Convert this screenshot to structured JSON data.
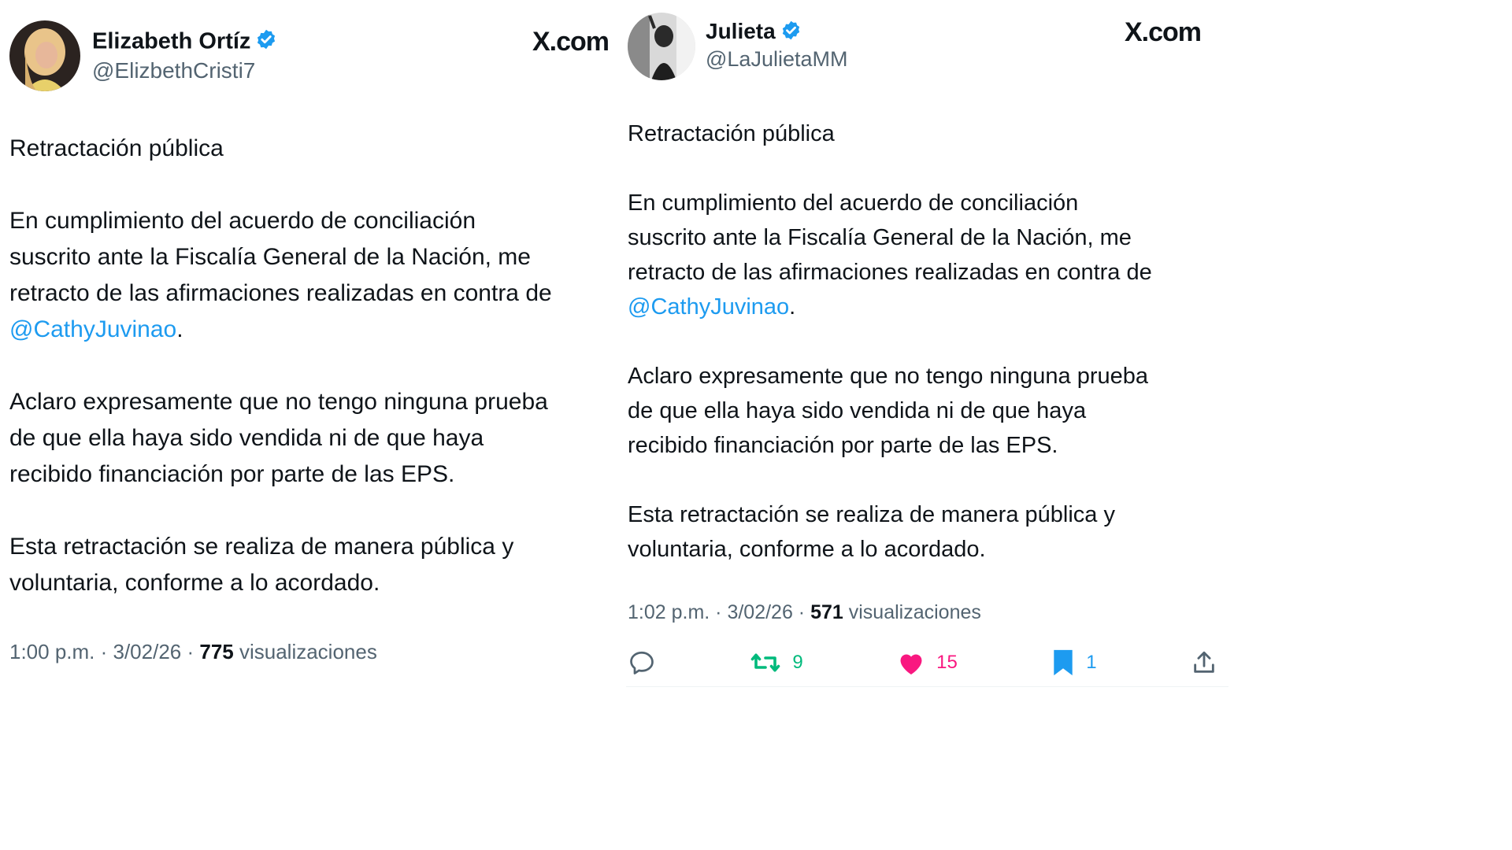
{
  "left_post": {
    "display_name": "Elizabeth Ortíz",
    "handle": "@ElizbethCristi7",
    "brand": "X.com",
    "title": "Retractación pública",
    "p1_lines": [
      "En cumplimiento del acuerdo de conciliación",
      "suscrito ante la Fiscalía General de la Nación, me",
      "retracto de las afirmaciones realizadas en contra de"
    ],
    "mention": "@CathyJuvinao",
    "mention_suffix": ".",
    "p2_lines": [
      "Aclaro expresamente que no tengo ninguna prueba",
      "de que ella haya sido vendida ni de que haya",
      "recibido financiación por parte de las EPS."
    ],
    "p3_lines": [
      "Esta retractación se realiza de manera pública y",
      "voluntaria, conforme a lo acordado."
    ],
    "timestamp": "1:00 p.m. · 3/02/26 · ",
    "views_count": "775",
    "views_label": " visualizaciones",
    "verified_icon": "verified-badge-icon"
  },
  "right_post": {
    "display_name": "Julieta",
    "handle": "@LaJulietaMM",
    "brand": "X.com",
    "title": "Retractación pública",
    "p1_lines": [
      "En cumplimiento del acuerdo de conciliación",
      "suscrito ante la Fiscalía General de la Nación, me",
      "retracto de las afirmaciones realizadas en contra de"
    ],
    "mention": "@CathyJuvinao",
    "mention_suffix": ".",
    "p2_lines": [
      "Aclaro expresamente que no tengo ninguna prueba",
      "de que ella haya sido vendida ni de que haya",
      "recibido financiación por parte de las EPS."
    ],
    "p3_lines": [
      "Esta retractación se realiza de manera pública y",
      "voluntaria, conforme a lo acordado."
    ],
    "timestamp": "1:02 p.m. · 3/02/26 · ",
    "views_count": "571",
    "views_label": " visualizaciones",
    "actions": {
      "reply_icon": "reply-icon",
      "retweet_icon": "retweet-icon",
      "retweets": "9",
      "like_icon": "heart-icon",
      "likes": "15",
      "bookmark_icon": "bookmark-icon",
      "bookmarks": "1",
      "share_icon": "share-icon"
    }
  },
  "colors": {
    "text": "#0f1419",
    "secondary": "#536471",
    "link": "#1d9bf0",
    "retweet": "#00ba7c",
    "like": "#f91880",
    "verified": "#1d9bf0"
  }
}
